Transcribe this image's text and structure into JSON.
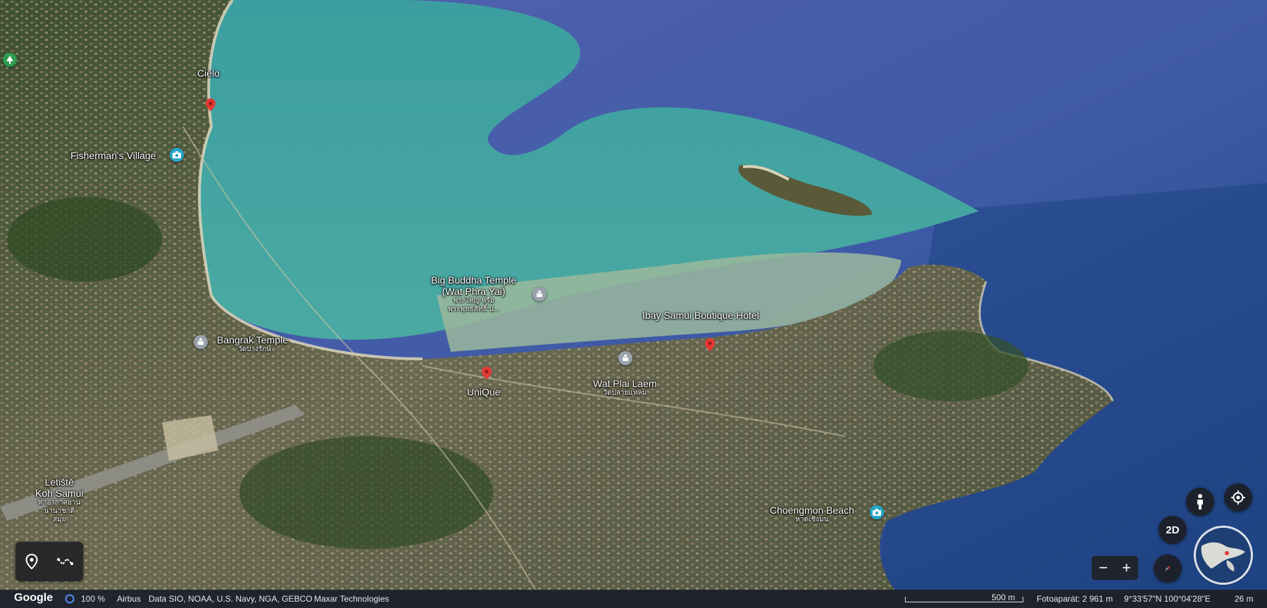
{
  "labels": {
    "cielo": "Cielo",
    "fishermans_village": "Fisherman's Village",
    "big_buddha_1": "Big Buddha Temple",
    "big_buddha_2": "(Wat Phra Yai)",
    "big_buddha_thai_1": "พระใหญ่ หรือ",
    "big_buddha_thai_2": "พระพุทธสิทธิ์ ป...",
    "ibay_samui": "Ibay Samui Boutique Hotel",
    "bangrak_temple": "Bangrak Temple",
    "bangrak_thai": "วัดบางรักษ์",
    "unique": "UniQue",
    "wat_plai_laem": "Wat Plai Laem",
    "wat_plai_laem_thai": "วัดปลายแหลม",
    "airport_1": "Letiště",
    "airport_2": "Koh Samui",
    "airport_thai_1": "ท่าอากาศยาน",
    "airport_thai_2": "นานาชาติ",
    "airport_thai_3": "สมุย",
    "choengmon_beach": "Choengmon Beach",
    "choengmon_thai": "หาดเชิงมน"
  },
  "controls": {
    "mode_2d": "2D",
    "zoom_out": "−",
    "zoom_in": "+",
    "pegman_icon": "person-icon",
    "locate_icon": "target-icon",
    "compass_icon": "compass-icon"
  },
  "bottom_bar": {
    "logo": "Google",
    "zoom_percent": "100 %",
    "attribution_1": "Airbus",
    "attribution_2": "Data SIO, NOAA, U.S. Navy, NGA, GEBCO",
    "attribution_3": "Maxar Technologies",
    "scale": "500 m",
    "camera": "Fotoaparát: 2 961 m",
    "coordinates": "9°33'57\"N 100°04'28\"E",
    "elevation": "26 m"
  },
  "colors": {
    "deep_sea": "#4a5fa8",
    "shallow_sea": "#3f9b9c",
    "land": "#4d5a3b",
    "pin_red": "#e53935",
    "poi_teal": "#26a6c8",
    "poi_gray": "#9aa3ad",
    "park_green": "#2e9c4f"
  }
}
